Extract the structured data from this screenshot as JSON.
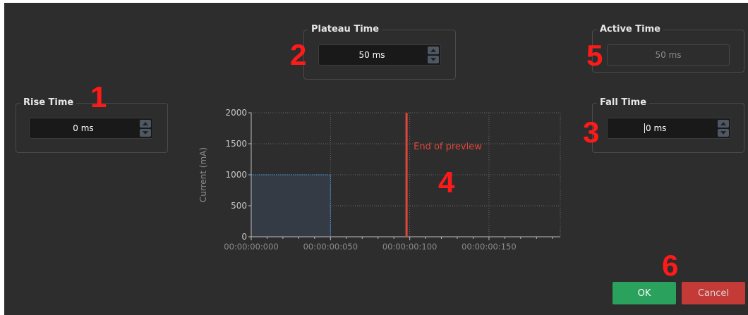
{
  "rise_time": {
    "title": "Rise Time",
    "value": "0 ms",
    "marker": "1"
  },
  "plateau_time": {
    "title": "Plateau Time",
    "value": "50 ms",
    "marker": "2"
  },
  "fall_time": {
    "title": "Fall Time",
    "value": "0 ms",
    "marker": "3"
  },
  "active_time": {
    "title": "Active Time",
    "value": "50 ms",
    "marker": "5"
  },
  "chart_marker": "4",
  "buttons_marker": "6",
  "buttons": {
    "ok": "OK",
    "cancel": "Cancel"
  },
  "colors": {
    "background": "#2d2d2d",
    "annotation": "#ff1a1a",
    "pulse_line": "#4a90d9",
    "pulse_fill": "#353b44",
    "preview_line": "#e0453a",
    "ok": "#2aa15c",
    "cancel": "#c43a36"
  },
  "chart_data": {
    "type": "line",
    "ylabel": "Current (mA)",
    "xlabel": "",
    "ylim": [
      0,
      2000
    ],
    "xlim_ms": [
      0,
      195
    ],
    "y_ticks": [
      "0",
      "500",
      "1000",
      "1500",
      "2000"
    ],
    "x_ticks": [
      {
        "ms": 0,
        "label": "00:00:00:000"
      },
      {
        "ms": 50,
        "label": "00:00:00:050"
      },
      {
        "ms": 100,
        "label": "00:00:00:100"
      },
      {
        "ms": 150,
        "label": "00:00:00:150"
      }
    ],
    "grid": true,
    "series": [
      {
        "x": [
          0,
          0,
          50,
          50
        ],
        "y": [
          0,
          1000,
          1000,
          0
        ]
      }
    ],
    "annotations": [
      {
        "type": "vline",
        "x": 98,
        "label": "End of preview"
      }
    ]
  }
}
